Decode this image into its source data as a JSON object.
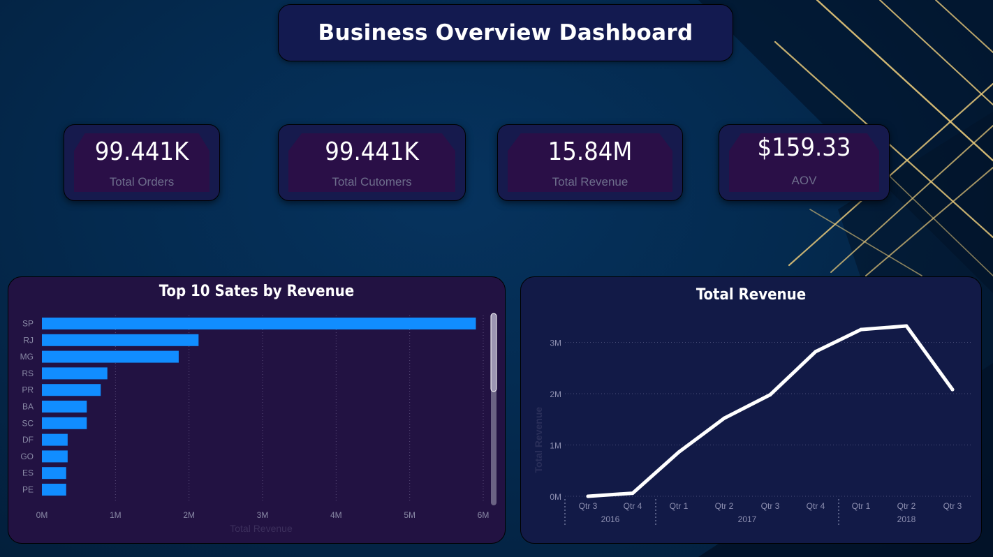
{
  "dashboard": {
    "title": "Business Overview Dashboard"
  },
  "kpis": [
    {
      "value": "99.441K",
      "label": "Total Orders"
    },
    {
      "value": "99.441K",
      "label": "Total Cutomers"
    },
    {
      "value": "15.84M",
      "label": "Total Revenue"
    },
    {
      "value": "$159.33",
      "label": "AOV"
    }
  ],
  "colors": {
    "bar": "#118dff",
    "line": "#ffffff",
    "accent_gold": "#e8c97a"
  },
  "chart_data": [
    {
      "type": "bar",
      "orientation": "horizontal",
      "title": "Top 10 Sates by Revenue",
      "xlabel": "Total Revenue",
      "ylabel": "",
      "categories": [
        "SP",
        "RJ",
        "MG",
        "RS",
        "PR",
        "BA",
        "SC",
        "DF",
        "GO",
        "ES",
        "PE"
      ],
      "values": [
        5.9,
        2.13,
        1.86,
        0.89,
        0.8,
        0.61,
        0.61,
        0.35,
        0.35,
        0.33,
        0.33
      ],
      "value_unit": "M",
      "xlim": [
        0,
        6
      ],
      "xticks": [
        "0M",
        "1M",
        "2M",
        "3M",
        "4M",
        "5M",
        "6M"
      ],
      "grid": true
    },
    {
      "type": "line",
      "title": "Total Revenue",
      "xlabel": "",
      "ylabel": "Total Revenue",
      "x": [
        "Qtr 3",
        "Qtr 4",
        "Qtr 1",
        "Qtr 2",
        "Qtr 3",
        "Qtr 4",
        "Qtr 1",
        "Qtr 2",
        "Qtr 3"
      ],
      "x_groups": [
        {
          "label": "2016",
          "quarters": [
            "Qtr 3",
            "Qtr 4"
          ]
        },
        {
          "label": "2017",
          "quarters": [
            "Qtr 1",
            "Qtr 2",
            "Qtr 3",
            "Qtr 4"
          ]
        },
        {
          "label": "2018",
          "quarters": [
            "Qtr 1",
            "Qtr 2",
            "Qtr 3"
          ]
        }
      ],
      "values": [
        0.0,
        0.06,
        0.86,
        1.52,
        1.98,
        2.82,
        3.25,
        3.32,
        2.08
      ],
      "value_unit": "M",
      "ylim": [
        0,
        3.3
      ],
      "yticks": [
        "0M",
        "1M",
        "2M",
        "3M"
      ],
      "grid": true
    }
  ]
}
